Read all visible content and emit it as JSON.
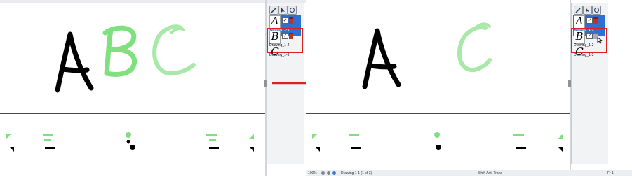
{
  "before": {
    "layers": [
      {
        "letter": "A",
        "name": "Drawing_1-1",
        "visible_mark": "✓",
        "selected": true,
        "highlighted": false
      },
      {
        "letter": "B",
        "name": "Drawing_1-2",
        "visible_mark": "✓",
        "selected": false,
        "highlighted": true
      },
      {
        "letter": "C",
        "name": "Drawing_1-3",
        "visible_mark": "✓",
        "selected": false,
        "highlighted": false
      }
    ],
    "canvas_letters": {
      "a_color": "#000000",
      "b_color": "#7fe07f",
      "c_color": "#a8e8a8"
    }
  },
  "after": {
    "layers": [
      {
        "letter": "A",
        "name": "Drawing_1-1",
        "visible_mark": "✓",
        "selected": true,
        "highlighted": false
      },
      {
        "letter": "B",
        "name": "Drawing_1-2",
        "visible_mark": "✓",
        "selected": false,
        "highlighted": true
      },
      {
        "letter": "C",
        "name": "Drawing_1-3",
        "visible_mark": "✓",
        "selected": false,
        "highlighted": false
      }
    ],
    "canvas_letters": {
      "a_color": "#000000",
      "c_color": "#a8e8a8"
    },
    "status_bar": {
      "zoom": "100%",
      "page_info": "Drawing 1-1 (1 of 3)",
      "tool": "Shift Anti-Trans",
      "right_info": "Fr 1"
    }
  },
  "colors": {
    "selection": "#2f6fd1",
    "highlight": "#e02020",
    "onion_green": "#7fe07f",
    "arrow": "#e02020"
  }
}
